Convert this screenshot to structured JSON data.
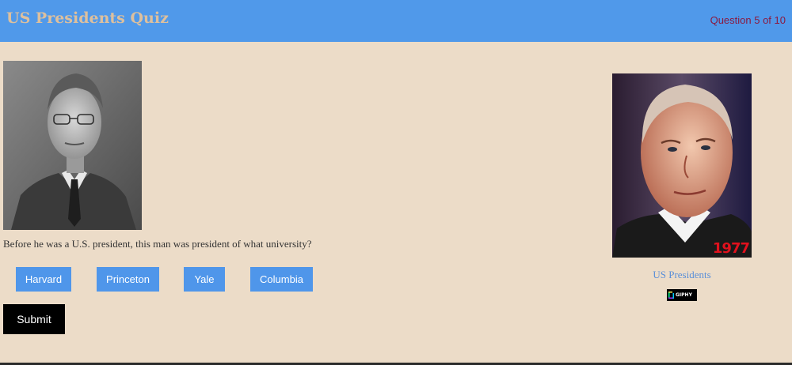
{
  "header": {
    "title": "US Presidents Quiz",
    "progress": "Question 5 of 10"
  },
  "question": {
    "image_subject": "president-portrait",
    "text": "Before he was a U.S. president, this man was president of what university?"
  },
  "answers": [
    {
      "label": "Harvard"
    },
    {
      "label": "Princeton"
    },
    {
      "label": "Yale"
    },
    {
      "label": "Columbia"
    }
  ],
  "submit_label": "Submit",
  "side_gif": {
    "year_overlay": "1977",
    "link_text": "US Presidents",
    "badge_text": "GIPHY"
  },
  "colors": {
    "header_bg": "#5099ea",
    "page_bg": "#ecdcc8",
    "title": "#ddc09e",
    "progress": "#8a1a40",
    "answer_bg": "#4f96ea",
    "submit_bg": "#000000",
    "year": "#e0111d",
    "link": "#5a8fd8"
  }
}
